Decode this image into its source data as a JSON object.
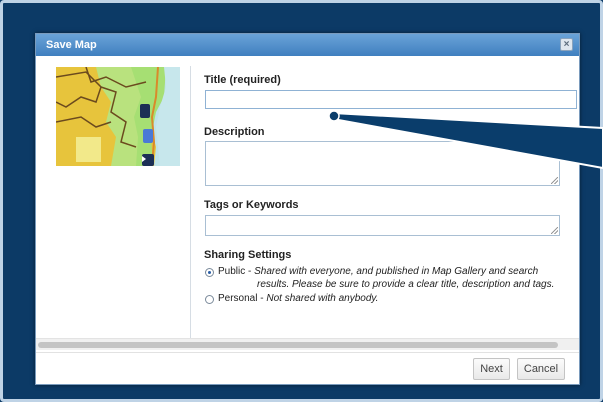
{
  "dialog": {
    "title": "Save Map",
    "close_label": "×"
  },
  "form": {
    "title_label": "Title (required)",
    "title_value": "",
    "description_label": "Description",
    "description_value": "",
    "tags_label": "Tags or Keywords",
    "tags_value": ""
  },
  "sharing": {
    "heading": "Sharing Settings",
    "options": [
      {
        "name": "Public",
        "sep": " - ",
        "desc": "Shared with everyone, and published in Map Gallery and search",
        "desc2": "results. Please be sure to provide a clear title, description and tags.",
        "checked": true
      },
      {
        "name": "Personal",
        "sep": " - ",
        "desc": "Not shared with anybody.",
        "checked": false
      }
    ]
  },
  "buttons": {
    "next": "Next",
    "cancel": "Cancel"
  },
  "colors": {
    "frame_border": "#bfd3e6",
    "background": "#0c3a66",
    "titlebar": "#4f8fcc",
    "callout_arrow": "#0a3d6b"
  }
}
